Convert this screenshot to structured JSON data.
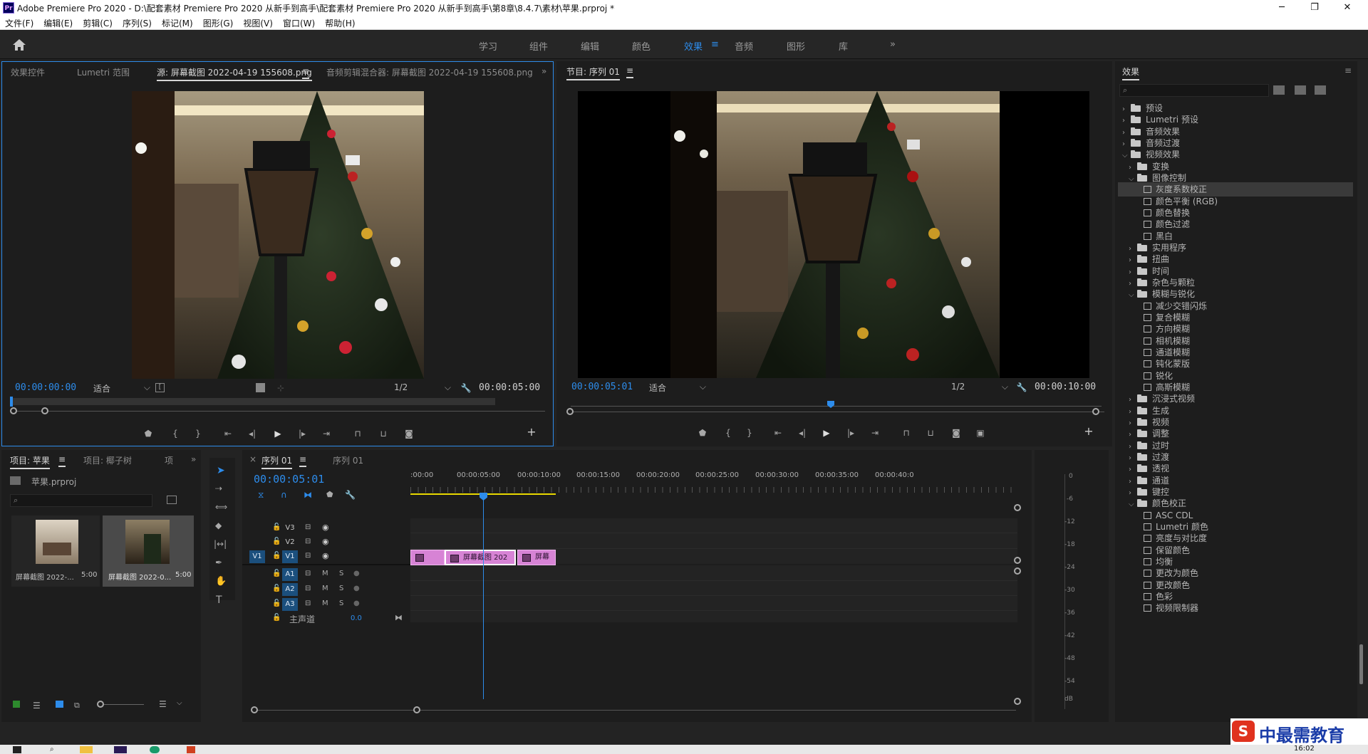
{
  "window": {
    "title": "Adobe Premiere Pro 2020 - D:\\配套素材 Premiere Pro 2020 从新手到高手\\配套素材 Premiere Pro 2020 从新手到高手\\第8章\\8.4.7\\素材\\苹果.prproj *",
    "logo": "Pr",
    "minimize": "─",
    "maximize": "❐",
    "close": "✕"
  },
  "menu": [
    "文件(F)",
    "编辑(E)",
    "剪辑(C)",
    "序列(S)",
    "标记(M)",
    "图形(G)",
    "视图(V)",
    "窗口(W)",
    "帮助(H)"
  ],
  "workspaces": {
    "tabs": [
      "学习",
      "组件",
      "编辑",
      "颜色",
      "效果",
      "音频",
      "图形",
      "库"
    ],
    "active": "效果",
    "menu_glyph": "≡",
    "more": "»"
  },
  "source": {
    "tabs": [
      "效果控件",
      "Lumetri 范围",
      "源: 屏幕截图 2022-04-19 155608.png",
      "音频剪辑混合器: 屏幕截图 2022-04-19 155608.png"
    ],
    "tab_menu": "≡",
    "more": "»",
    "timecode": "00:00:00:00",
    "fit": "适合",
    "resolution": "1/2",
    "duration": "00:00:05:00"
  },
  "program": {
    "title": "节目: 序列 01",
    "title_menu": "≡",
    "timecode": "00:00:05:01",
    "fit": "适合",
    "resolution": "1/2",
    "duration": "00:00:10:00"
  },
  "project": {
    "tabs": [
      "项目: 苹果",
      "项目: 椰子树",
      "项"
    ],
    "tab_menu": "≡",
    "more": "»",
    "file": "苹果.prproj",
    "items": [
      {
        "name": "屏幕截图 2022-...",
        "duration": "5:00"
      },
      {
        "name": "屏幕截图 2022-0...",
        "duration": "5:00"
      }
    ]
  },
  "timeline": {
    "tabs": [
      "序列 01",
      "序列 01"
    ],
    "close": "×",
    "tab_menu": "≡",
    "timecode": "00:00:05:01",
    "ruler": [
      ":00:00",
      "00:00:05:00",
      "00:00:10:00",
      "00:00:15:00",
      "00:00:20:00",
      "00:00:25:00",
      "00:00:30:00",
      "00:00:35:00",
      "00:00:40:0"
    ],
    "tracks_video": [
      "V3",
      "V2",
      "V1"
    ],
    "tracks_audio": [
      "A1",
      "A2",
      "A3"
    ],
    "source_patch": "V1",
    "mute": "M",
    "solo": "S",
    "master_label": "主声道",
    "master_value": "0.0",
    "clips": [
      {
        "label": ""
      },
      {
        "label": "屏幕截图 202"
      },
      {
        "label": "屏幕"
      }
    ]
  },
  "meter": {
    "labels": [
      "0",
      "-6",
      "-12",
      "-18",
      "-24",
      "-30",
      "-36",
      "-42",
      "-48",
      "-54",
      "dB"
    ]
  },
  "effects": {
    "title": "效果",
    "menu": "≡",
    "items": [
      {
        "label": "预设",
        "level": 0,
        "open": false,
        "type": "folder-star"
      },
      {
        "label": "Lumetri 预设",
        "level": 0,
        "open": false,
        "type": "folder-star"
      },
      {
        "label": "音频效果",
        "level": 0,
        "open": false,
        "type": "folder"
      },
      {
        "label": "音频过渡",
        "level": 0,
        "open": false,
        "type": "folder"
      },
      {
        "label": "视频效果",
        "level": 0,
        "open": true,
        "type": "folder"
      },
      {
        "label": "变换",
        "level": 1,
        "open": false,
        "type": "folder"
      },
      {
        "label": "图像控制",
        "level": 1,
        "open": true,
        "type": "folder"
      },
      {
        "label": "灰度系数校正",
        "level": 2,
        "type": "fx",
        "selected": true
      },
      {
        "label": "颜色平衡 (RGB)",
        "level": 2,
        "type": "fx"
      },
      {
        "label": "颜色替换",
        "level": 2,
        "type": "fx"
      },
      {
        "label": "颜色过滤",
        "level": 2,
        "type": "fx"
      },
      {
        "label": "黑白",
        "level": 2,
        "type": "fx"
      },
      {
        "label": "实用程序",
        "level": 1,
        "open": false,
        "type": "folder"
      },
      {
        "label": "扭曲",
        "level": 1,
        "open": false,
        "type": "folder"
      },
      {
        "label": "时间",
        "level": 1,
        "open": false,
        "type": "folder"
      },
      {
        "label": "杂色与颗粒",
        "level": 1,
        "open": false,
        "type": "folder"
      },
      {
        "label": "模糊与锐化",
        "level": 1,
        "open": true,
        "type": "folder"
      },
      {
        "label": "减少交错闪烁",
        "level": 2,
        "type": "fx"
      },
      {
        "label": "复合模糊",
        "level": 2,
        "type": "fx"
      },
      {
        "label": "方向模糊",
        "level": 2,
        "type": "fx"
      },
      {
        "label": "相机模糊",
        "level": 2,
        "type": "fx"
      },
      {
        "label": "通道模糊",
        "level": 2,
        "type": "fx"
      },
      {
        "label": "钝化蒙版",
        "level": 2,
        "type": "fx"
      },
      {
        "label": "锐化",
        "level": 2,
        "type": "fx"
      },
      {
        "label": "高斯模糊",
        "level": 2,
        "type": "fx"
      },
      {
        "label": "沉浸式视频",
        "level": 1,
        "open": false,
        "type": "folder"
      },
      {
        "label": "生成",
        "level": 1,
        "open": false,
        "type": "folder"
      },
      {
        "label": "视频",
        "level": 1,
        "open": false,
        "type": "folder"
      },
      {
        "label": "调整",
        "level": 1,
        "open": false,
        "type": "folder"
      },
      {
        "label": "过时",
        "level": 1,
        "open": false,
        "type": "folder"
      },
      {
        "label": "过渡",
        "level": 1,
        "open": false,
        "type": "folder"
      },
      {
        "label": "透视",
        "level": 1,
        "open": false,
        "type": "folder"
      },
      {
        "label": "通道",
        "level": 1,
        "open": false,
        "type": "folder"
      },
      {
        "label": "键控",
        "level": 1,
        "open": false,
        "type": "folder"
      },
      {
        "label": "颜色校正",
        "level": 1,
        "open": true,
        "type": "folder"
      },
      {
        "label": "ASC CDL",
        "level": 2,
        "type": "fx"
      },
      {
        "label": "Lumetri 颜色",
        "level": 2,
        "type": "fx"
      },
      {
        "label": "亮度与对比度",
        "level": 2,
        "type": "fx"
      },
      {
        "label": "保留颜色",
        "level": 2,
        "type": "fx"
      },
      {
        "label": "均衡",
        "level": 2,
        "type": "fx"
      },
      {
        "label": "更改为颜色",
        "level": 2,
        "type": "fx"
      },
      {
        "label": "更改颜色",
        "level": 2,
        "type": "fx"
      },
      {
        "label": "色彩",
        "level": 2,
        "type": "fx"
      },
      {
        "label": "视频限制器",
        "level": 2,
        "type": "fx"
      }
    ]
  },
  "taskbar": {
    "time": "16:02"
  },
  "watermark": {
    "text": "中最需教育"
  },
  "colors": {
    "accent": "#2d8ceb",
    "clip": "#d783d5",
    "playhead": "#2d8ceb",
    "work_area": "#e8d800"
  }
}
